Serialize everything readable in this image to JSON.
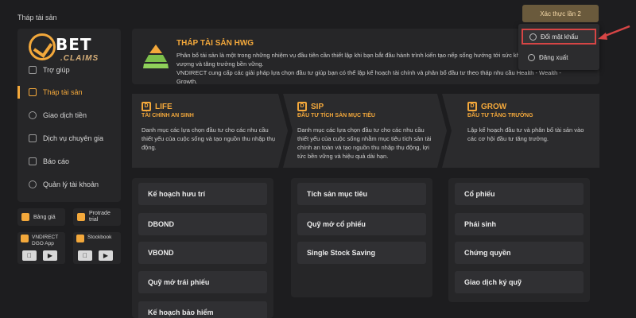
{
  "page": {
    "label": "Tháp tài sản"
  },
  "logo": {
    "text_main": "BET",
    "text_sub": ".CLAIMS"
  },
  "sidebar": {
    "items": [
      {
        "label": "Trợ giúp",
        "icon": "help-icon"
      },
      {
        "label": "Tháp tài sản",
        "icon": "tower-icon",
        "active": true
      },
      {
        "label": "Giao dịch tiền",
        "icon": "money-icon"
      },
      {
        "label": "Dịch vụ chuyên gia",
        "icon": "expert-icon"
      },
      {
        "label": "Báo cáo",
        "icon": "report-icon"
      },
      {
        "label": "Quản lý tài khoản",
        "icon": "user-icon"
      }
    ]
  },
  "apps": {
    "bang_gia": "Bảng giá",
    "protrade": "Protrade trial",
    "dgo": "VNDIRECT DGO App",
    "stockbook": "Stockbook"
  },
  "hero": {
    "title": "THÁP TÀI SẢN HWG",
    "line1": "Phân bổ tài sản là một trong những nhiệm vụ đầu tiên cần thiết lập khi bạn bắt đầu hành trình kiến tạo nếp sống hướng tới sức kh",
    "line2": "vượng và tăng trưởng bền vững.",
    "line3": "VNDIRECT cung cấp các giải pháp lựa chọn đầu tư giúp bạn có thể lập kế hoạch tài chính và phân bổ đầu tư theo tháp nhu cầu Health - Wealth - Growth."
  },
  "strategies": [
    {
      "name": "LIFE",
      "subtitle": "TÀI CHÍNH AN SINH",
      "desc": "Danh mục các lựa chọn đầu tư cho các nhu cầu thiết yếu của cuộc sống và tạo nguồn thu nhập thụ động."
    },
    {
      "name": "SIP",
      "subtitle": "ĐẦU TƯ TÍCH SẢN MỤC TIÊU",
      "desc": "Danh mục các lựa chọn đầu tư cho các nhu cầu thiết yếu của cuộc sống nhằm mục tiêu tích sản tài chính an toàn và tạo nguồn thu nhập thụ động, lợi tức bền vững và hiệu quả dài hạn."
    },
    {
      "name": "GROW",
      "subtitle": "ĐẦU TƯ TĂNG TRƯỞNG",
      "desc": "Lập kế hoạch đầu tư và phân bổ tài sản vào các cơ hội đầu tư tăng trưởng."
    }
  ],
  "columns": [
    {
      "items": [
        "Kế hoạch hưu trí",
        "DBOND",
        "VBOND",
        "Quỹ mở trái phiếu",
        "Kế hoạch bảo hiểm"
      ]
    },
    {
      "items": [
        "Tích sản mục tiêu",
        "Quỹ mở cổ phiếu",
        "Single Stock Saving"
      ]
    },
    {
      "items": [
        "Cổ phiếu",
        "Phái sinh",
        "Chứng quyền",
        "Giao dịch ký quỹ"
      ]
    }
  ],
  "account": {
    "top_button": "Xác thực lần 2",
    "menu": [
      {
        "label": "Đổi mật khẩu",
        "icon": "key-icon"
      },
      {
        "label": "Đăng xuất",
        "icon": "logout-icon"
      }
    ]
  },
  "colors": {
    "accent": "#f3a83b",
    "background": "#1d1d1f",
    "panel": "#262628",
    "highlight": "#d64545"
  }
}
